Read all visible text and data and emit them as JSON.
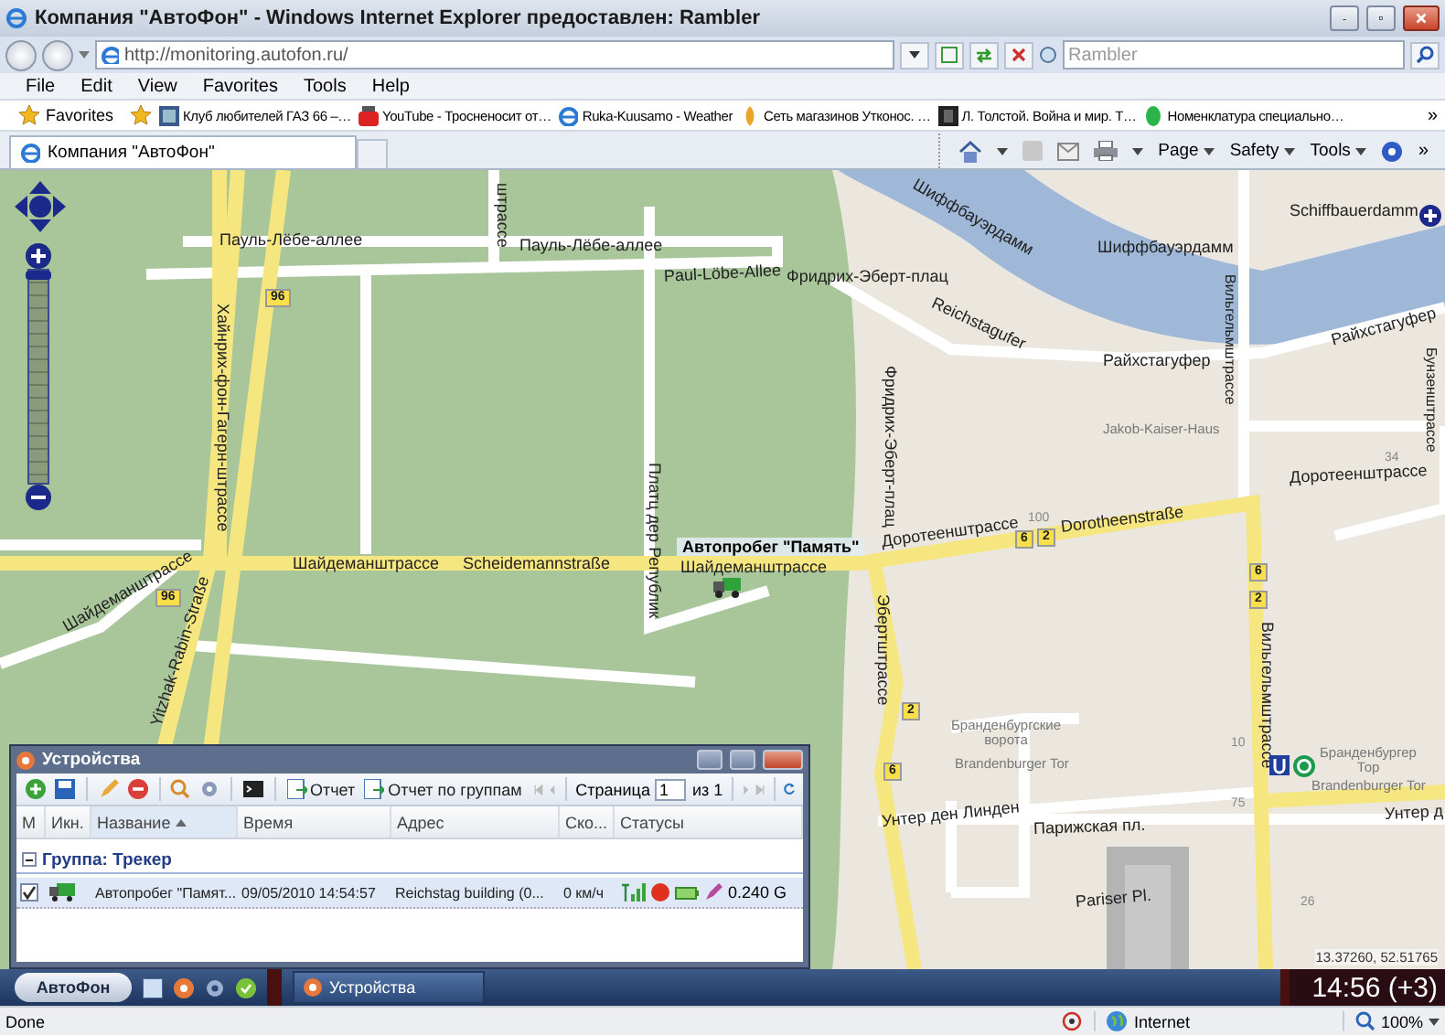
{
  "window": {
    "title": "Компания \"АвтоФон\" - Windows Internet Explorer предоставлен: Rambler"
  },
  "address_bar": {
    "url": "http://monitoring.autofon.ru/",
    "search_placeholder": "Rambler"
  },
  "menu": [
    "File",
    "Edit",
    "View",
    "Favorites",
    "Tools",
    "Help"
  ],
  "favorites_bar": {
    "button": "Favorites",
    "links": [
      {
        "label": "Клуб любителей ГАЗ 66 –…"
      },
      {
        "label": "YouTube - Тросненосит от…"
      },
      {
        "label": "Ruka-Kuusamo - Weather"
      },
      {
        "label": "Сеть магазинов Утконос. …"
      },
      {
        "label": "Л. Толстой. Война и мир. Т…"
      },
      {
        "label": "Номенклатура специально…"
      }
    ],
    "more": "»"
  },
  "tab": {
    "title": "Компания \"АвтоФон\""
  },
  "command_bar": {
    "menus": [
      "Page",
      "Safety",
      "Tools"
    ],
    "more": "»"
  },
  "map": {
    "zoom_slider": {
      "level": 1
    },
    "labels": [
      {
        "text": "Пауль-Лёбе-аллее",
        "kind": "street"
      },
      {
        "text": "Пауль-Лёбе-аллее",
        "kind": "street"
      },
      {
        "text": "Paul-Löbe-Allee",
        "kind": "street"
      },
      {
        "text": "Фридрих-Эберт-плац",
        "kind": "street"
      },
      {
        "text": "Хайнрих-фон-Гагерн-штрассе",
        "kind": "street"
      },
      {
        "text": "96",
        "kind": "badge"
      },
      {
        "text": "96",
        "kind": "badge"
      },
      {
        "text": "Шайдеманштрассе",
        "kind": "street"
      },
      {
        "text": "Scheidemannstraße",
        "kind": "street"
      },
      {
        "text": "Шайдеманштрассе",
        "kind": "street"
      },
      {
        "text": "Шайдеманштрассе",
        "kind": "street"
      },
      {
        "text": "Yitzhak-Rabin-Straße",
        "kind": "street"
      },
      {
        "text": "Платц дер Републик",
        "kind": "street"
      },
      {
        "text": "штрассе",
        "kind": "street"
      },
      {
        "text": "Шиффбауэрдамм",
        "kind": "street"
      },
      {
        "text": "Шиффбауэрдамм",
        "kind": "street"
      },
      {
        "text": "Schiffbauerdamm",
        "kind": "street"
      },
      {
        "text": "Reichstagufer",
        "kind": "street"
      },
      {
        "text": "Райхстагуфер",
        "kind": "street"
      },
      {
        "text": "Райхстагуфер",
        "kind": "street"
      },
      {
        "text": "Вильгельмштрассе",
        "kind": "street"
      },
      {
        "text": "Бунзенштрассе",
        "kind": "street"
      },
      {
        "text": "Jakob-Kaiser-Haus",
        "kind": "poi"
      },
      {
        "text": "34",
        "kind": "number"
      },
      {
        "text": "Доротеенштрассе",
        "kind": "street"
      },
      {
        "text": "Фридрих-Эберт-плац",
        "kind": "street"
      },
      {
        "text": "100",
        "kind": "number"
      },
      {
        "text": "Доротеенштрассе",
        "kind": "street"
      },
      {
        "text": "6",
        "kind": "badge"
      },
      {
        "text": "2",
        "kind": "badge"
      },
      {
        "text": "Dorotheenstraße",
        "kind": "street"
      },
      {
        "text": "6",
        "kind": "badge"
      },
      {
        "text": "2",
        "kind": "badge"
      },
      {
        "text": "Вильгельмштрассе",
        "kind": "street"
      },
      {
        "text": "Эбертштрассе",
        "kind": "street"
      },
      {
        "text": "2",
        "kind": "badge"
      },
      {
        "text": "6",
        "kind": "badge"
      },
      {
        "text": "Бранденбургские ворота",
        "kind": "poi"
      },
      {
        "text": "Brandenburger Tor",
        "kind": "poi"
      },
      {
        "text": "10",
        "kind": "number"
      },
      {
        "text": "Бранденбургер Тор",
        "kind": "poi"
      },
      {
        "text": "Brandenburger Tor",
        "kind": "poi"
      },
      {
        "text": "Унтер ден Линден",
        "kind": "street"
      },
      {
        "text": "75",
        "kind": "number"
      },
      {
        "text": "Унтер д",
        "kind": "street"
      },
      {
        "text": "Парижская пл.",
        "kind": "street"
      },
      {
        "text": "Pariser Pl.",
        "kind": "street"
      },
      {
        "text": "26",
        "kind": "number"
      }
    ],
    "marker": {
      "label": "Автопробег \"Память\""
    },
    "coordinates": "13.37260, 52.51765"
  },
  "devices_window": {
    "title": "Устройства",
    "toolbar": {
      "reports": [
        "Отчет",
        "Отчет по группам"
      ],
      "page_label": "Страница",
      "page_value": "1",
      "page_total": "из 1"
    },
    "columns": [
      "М",
      "Икн.",
      "Название",
      "Время",
      "Адрес",
      "Ско...",
      "Статусы"
    ],
    "groups": [
      {
        "title": "Группа: Трекер",
        "expanded": true,
        "rows": [
          {
            "checked": true,
            "selected": true,
            "name": "Автопробег \"Памят...",
            "time": "09/05/2010 14:54:57",
            "address": "Reichstag building (0...",
            "speed": "0 км/ч",
            "reading": "0.240 G"
          }
        ]
      }
    ]
  },
  "taskbar": {
    "start": "АвтоФон",
    "tasks": [
      {
        "label": "Устройства"
      }
    ],
    "clock": "14:56 (+3)"
  },
  "status_bar": {
    "text": "Done",
    "zone": "Internet",
    "zoom": "100%"
  }
}
